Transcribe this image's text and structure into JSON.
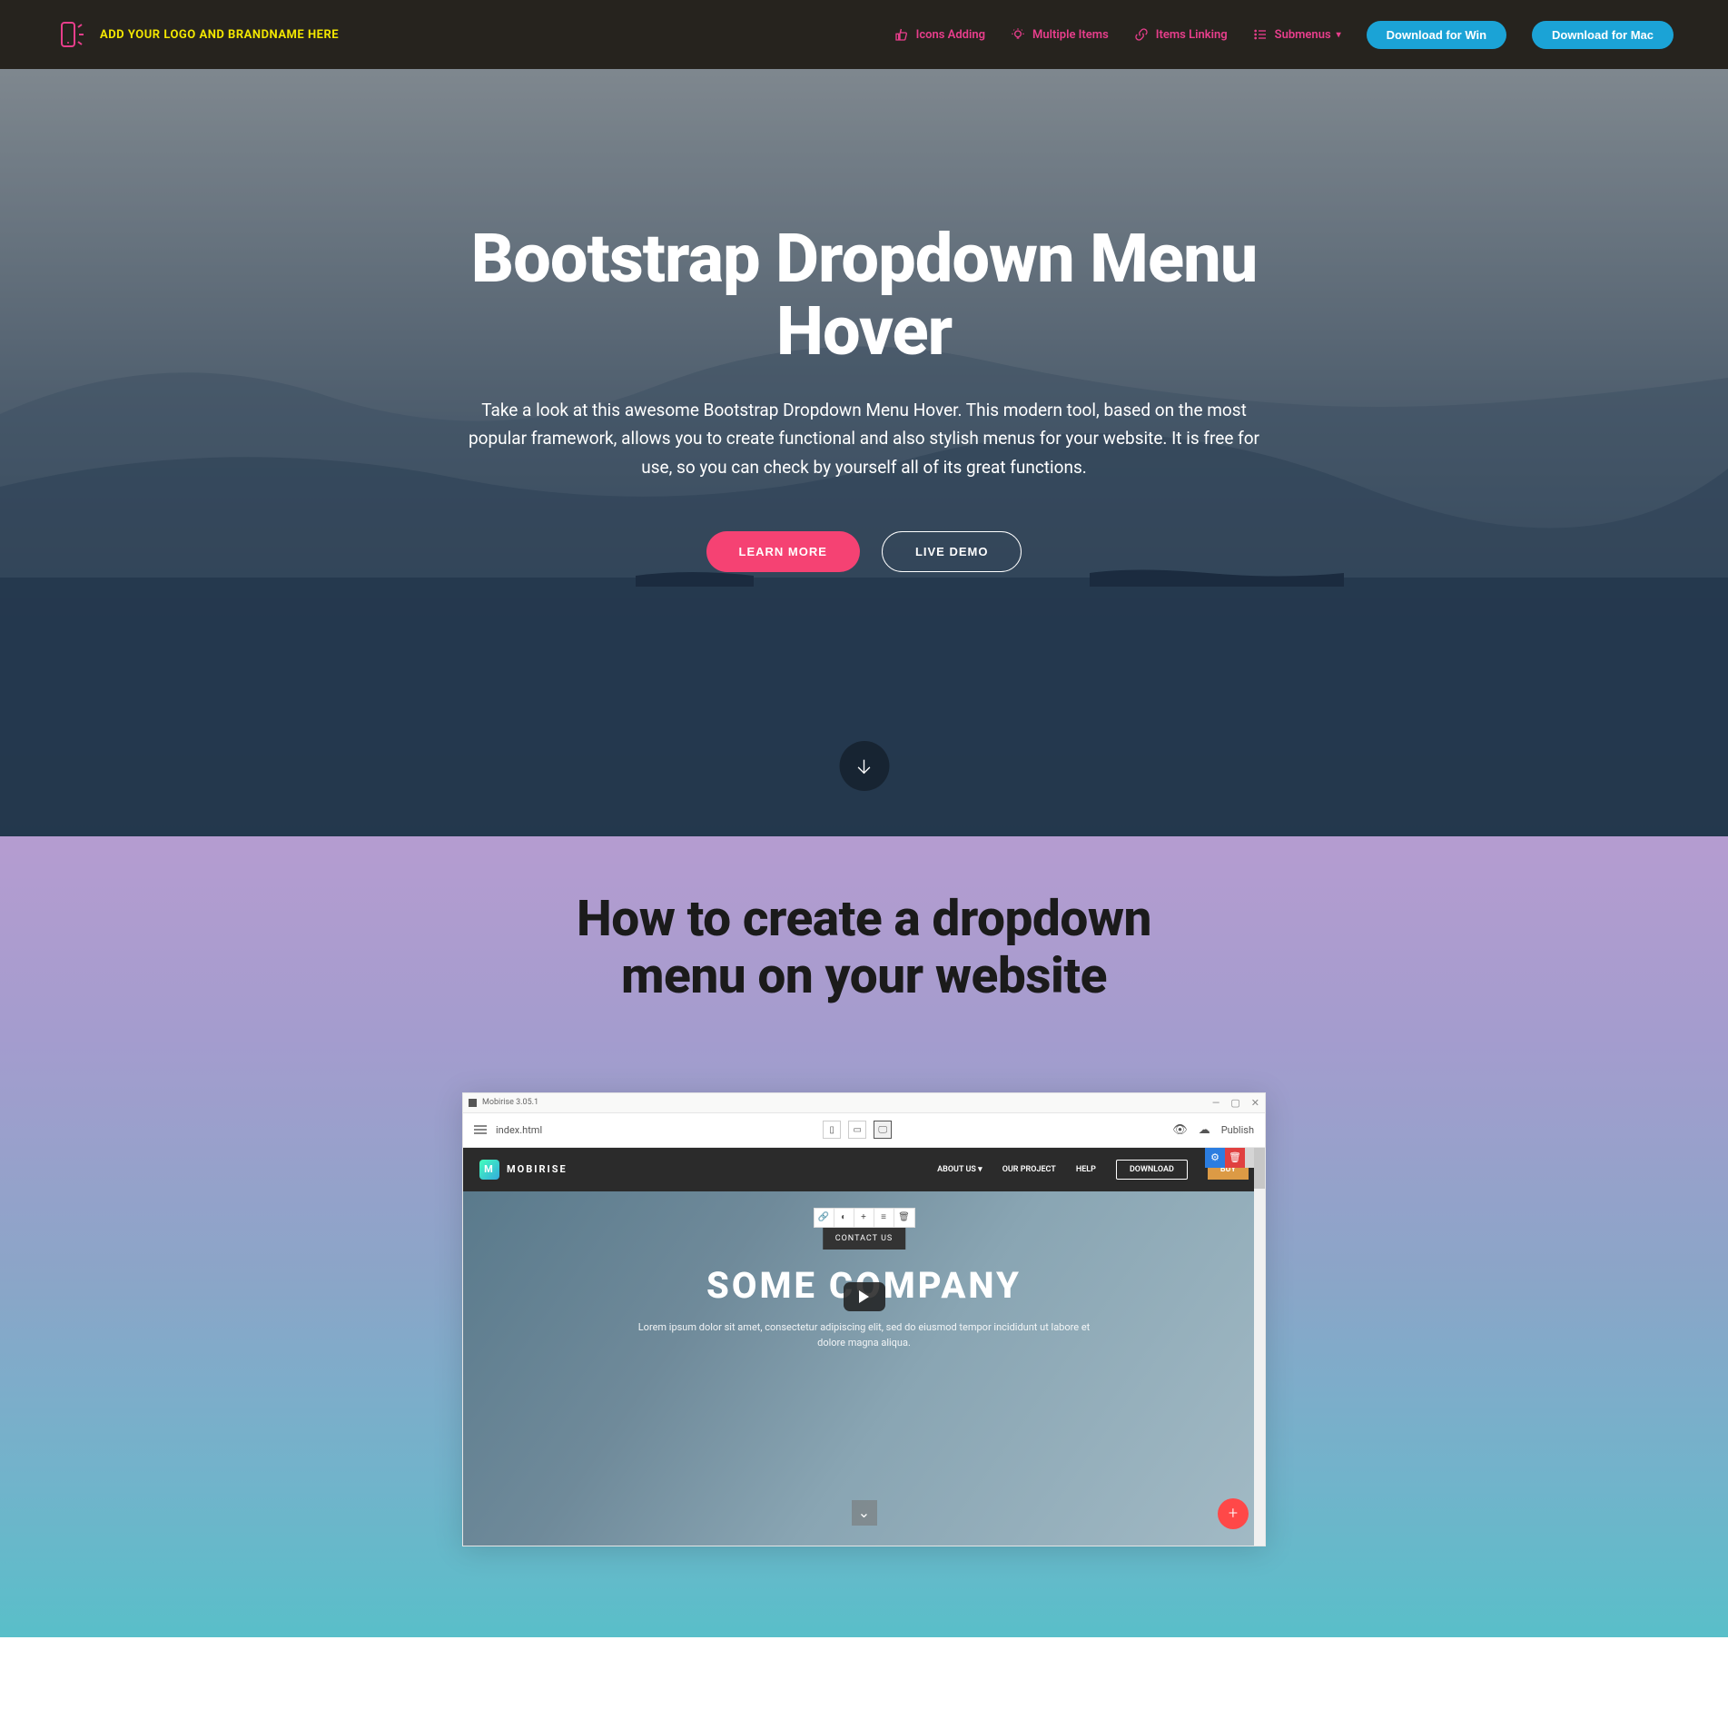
{
  "navbar": {
    "brand_text": "ADD YOUR LOGO AND BRANDNAME HERE",
    "links": [
      {
        "label": "Icons Adding"
      },
      {
        "label": "Multiple Items"
      },
      {
        "label": "Items Linking"
      },
      {
        "label": "Submenus"
      }
    ],
    "download_win": "Download for Win",
    "download_mac": "Download for Mac"
  },
  "hero": {
    "title": "Bootstrap Dropdown Menu Hover",
    "description": "Take a look at this awesome Bootstrap Dropdown Menu Hover. This modern tool, based on the most popular framework, allows you to create functional and also stylish menus for your website. It is free for use, so you can check by yourself all of its great functions.",
    "learn_more": "LEARN MORE",
    "live_demo": "LIVE DEMO"
  },
  "section_video": {
    "title": "How to create a dropdown menu on your website",
    "app_title": "Mobirise 3.05.1",
    "file_name": "index.html",
    "publish_label": "Publish",
    "inner_brand": "MOBIRISE",
    "inner_links": {
      "about": "ABOUT US",
      "project": "OUR PROJECT",
      "help": "HELP",
      "download": "DOWNLOAD",
      "buy": "BUY"
    },
    "contact_tab": "CONTACT US",
    "company_title": "SOME COMPANY",
    "company_desc": "Lorem ipsum dolor sit amet, consectetur adipiscing elit, sed do eiusmod tempor incididunt ut labore et dolore magna aliqua."
  }
}
